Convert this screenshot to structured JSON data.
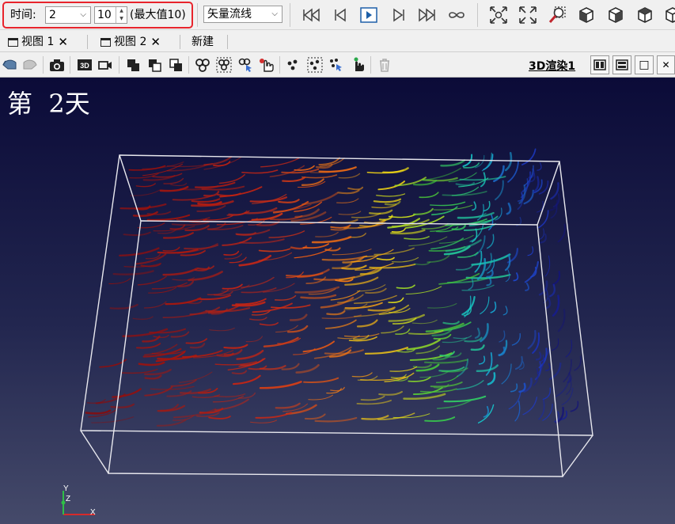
{
  "time_toolbar": {
    "time_label": "时间:",
    "time_value": "2",
    "max_spin_value": "10",
    "max_label": "(最大值10)"
  },
  "representation": {
    "selected": "矢量流线"
  },
  "tabs": [
    {
      "label": "视图 1"
    },
    {
      "label": "视图 2"
    },
    {
      "label": "新建"
    }
  ],
  "view_toolbar": {
    "render_view_title": "3D渲染1"
  },
  "viewport": {
    "day_label": "第  2天"
  },
  "axes": {
    "x": "X",
    "y": "Y",
    "z": "Z"
  },
  "icons": {
    "close": "✕",
    "window": "□"
  }
}
